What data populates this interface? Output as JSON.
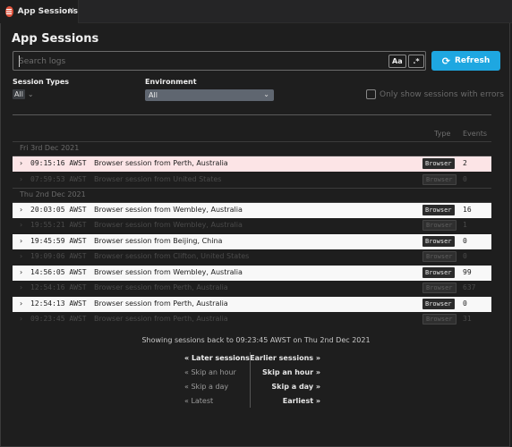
{
  "tab": {
    "title": "App Sessions",
    "close": "×",
    "icon": "app-sessions-icon"
  },
  "page": {
    "title": "App Sessions"
  },
  "search": {
    "placeholder": "Search logs",
    "value": "",
    "match_case_label": "Aa",
    "regex_label": ".*"
  },
  "refresh": {
    "label": "Refresh",
    "icon": "refresh-icon",
    "color": "#1ea7e1"
  },
  "filters": {
    "session_types_label": "Session Types",
    "session_types_value": "All",
    "environment_label": "Environment",
    "environment_value": "All",
    "errors_only_label": "Only show sessions with errors"
  },
  "columns": {
    "type": "Type",
    "events": "Events"
  },
  "groups": [
    {
      "date": "Fri 3rd Dec 2021",
      "rows": [
        {
          "time": "09:15:16 AWST",
          "desc": "Browser session from Perth, Australia",
          "type": "Browser",
          "events": "2",
          "style": "pink"
        },
        {
          "time": "07:59:53 AWST",
          "desc": "Browser session from United States",
          "type": "Browser",
          "events": "0",
          "style": "dim"
        }
      ]
    },
    {
      "date": "Thu 2nd Dec 2021",
      "rows": [
        {
          "time": "20:03:05 AWST",
          "desc": "Browser session from Wembley, Australia",
          "type": "Browser",
          "events": "16",
          "style": "bright"
        },
        {
          "time": "19:55:21 AWST",
          "desc": "Browser session from Wembley, Australia",
          "type": "Browser",
          "events": "1",
          "style": "dim"
        },
        {
          "time": "19:45:59 AWST",
          "desc": "Browser session from Beijing, China",
          "type": "Browser",
          "events": "0",
          "style": "bright"
        },
        {
          "time": "19:09:06 AWST",
          "desc": "Browser session from Clifton, United States",
          "type": "Browser",
          "events": "0",
          "style": "dim"
        },
        {
          "time": "14:56:05 AWST",
          "desc": "Browser session from Wembley, Australia",
          "type": "Browser",
          "events": "99",
          "style": "bright"
        },
        {
          "time": "12:54:16 AWST",
          "desc": "Browser session from Perth, Australia",
          "type": "Browser",
          "events": "637",
          "style": "dim"
        },
        {
          "time": "12:54:13 AWST",
          "desc": "Browser session from Perth, Australia",
          "type": "Browser",
          "events": "0",
          "style": "bright"
        },
        {
          "time": "09:23:45 AWST",
          "desc": "Browser session from Perth, Australia",
          "type": "Browser",
          "events": "31",
          "style": "dim"
        }
      ]
    }
  ],
  "status": "Showing sessions back to 09:23:45 AWST on Thu 2nd Dec 2021",
  "nav": {
    "later_sessions": "« Later sessions",
    "skip_hour_back": "« Skip an hour",
    "skip_day_back": "« Skip a day",
    "latest": "« Latest",
    "earlier_sessions": "Earlier sessions »",
    "skip_hour_fwd": "Skip an hour »",
    "skip_day_fwd": "Skip a day »",
    "earliest": "Earliest »"
  }
}
